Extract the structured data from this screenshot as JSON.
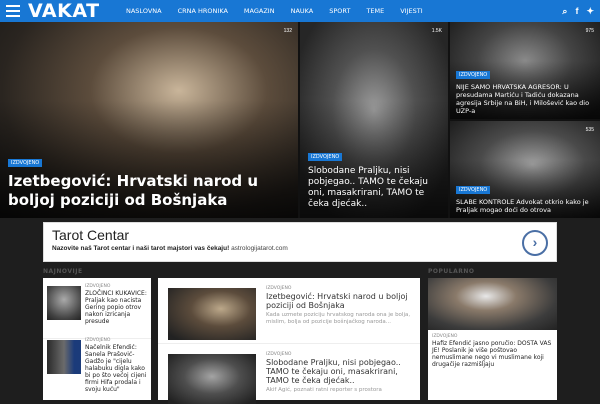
{
  "site": {
    "logo": "VAKAT"
  },
  "nav": [
    "NASLOVNA",
    "CRNA HRONIKA",
    "MAGAZIN",
    "NAUKA",
    "SPORT",
    "TEME",
    "VIJESTI"
  ],
  "icons": {
    "menu": "hamburger-icon",
    "search": "search-icon",
    "facebook": "facebook-icon",
    "twitter": "twitter-icon"
  },
  "icon_glyphs": {
    "search": "⌕",
    "facebook": "f",
    "twitter": "✦",
    "next": "›"
  },
  "colors": {
    "brand": "#1877d4",
    "tag": "#1877d4"
  },
  "hero": {
    "main": {
      "tag": "IZDVOJENO",
      "views": "132",
      "title": "Izetbegović: Hrvatski narod u boljoj poziciji od Bošnjaka"
    },
    "mid": {
      "tag": "IZDVOJENO",
      "views": "1.5K",
      "title": "Slobodane Praljku, nisi pobjegao.. TAMO te čekaju oni, masakrirani, TAMO te čeka djećak.."
    },
    "right_top": {
      "tag": "IZDVOJENO",
      "views": "975",
      "title": "NIJE SAMO HRVATSKA AGRESOR: U presudama Martiću i Tadiću dokazana agresija Srbije na BiH, i Milošević kao dio UZP-a"
    },
    "right_bottom": {
      "tag": "IZDVOJENO",
      "views": "535",
      "title": "SLABE KONTROLE Advokat otkrio kako je Praljak mogao doći do otrova"
    }
  },
  "ad": {
    "title": "Tarot Centar",
    "line_bold": "Nazovite naš Tarot centar i naši tarot majstori vas čekaju!",
    "line_url": "astrologijatarot.com"
  },
  "sections": {
    "najnovije": "NAJNOVIJE",
    "popularno": "POPULARNO"
  },
  "najnovije": [
    {
      "tag": "IZDVOJENO",
      "title": "ZLOČINCI KUKAVICE: Praljak kao nacista Gering popio otrov nakon izricanja presude"
    },
    {
      "tag": "IZDVOJENO",
      "title": "Načelnik Efendić: Sanela Prašović-Gadžo je \"cijelu halabuku digla kako bi po što većoj cijeni firmi Hifa prodala i svoju kuću\""
    }
  ],
  "center": [
    {
      "tag": "IZDVOJENO",
      "title": "Izetbegović: Hrvatski narod u boljoj poziciji od Bošnjaka",
      "excerpt": "Kada uzmete poziciju hrvatskog naroda ona je bolja, mislim, bolja od pozicije bošnjačkog naroda..."
    },
    {
      "tag": "IZDVOJENO",
      "title": "Slobodane Praljku, nisi pobjegao.. TAMO te čekaju oni, masakrirani, TAMO te čeka djećak..",
      "excerpt": "Akif Agić, poznati ratni reporter s prostora"
    }
  ],
  "popularno": [
    {
      "tag": "IZDVOJENO",
      "title": "Hafiz Efendić jasno poručio: DOSTA VAS JE! Poslanik je više poštovao nemuslimane nego vi muslimane koji drugačije razmišljaju"
    }
  ]
}
